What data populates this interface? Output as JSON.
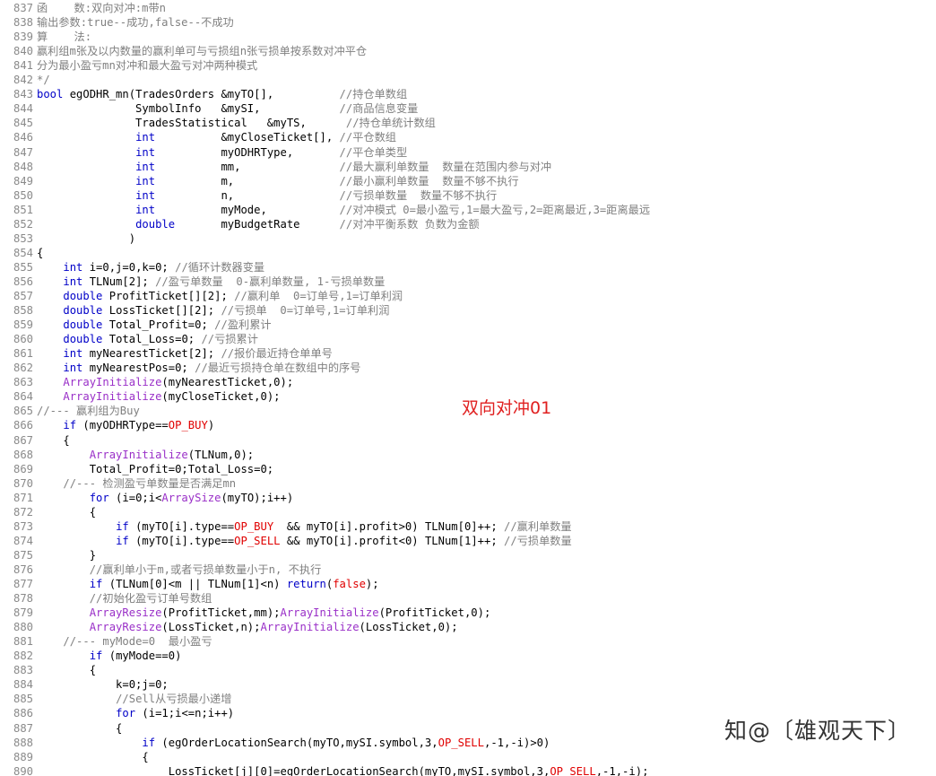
{
  "lines": [
    {
      "n": "837",
      "segs": [
        {
          "t": "函    数:双向对冲:m带n",
          "c": "cm"
        }
      ]
    },
    {
      "n": "838",
      "segs": [
        {
          "t": "输出参数:true--成功,false--不成功",
          "c": "cm"
        }
      ]
    },
    {
      "n": "839",
      "segs": [
        {
          "t": "算    法:",
          "c": "cm"
        }
      ]
    },
    {
      "n": "840",
      "segs": [
        {
          "t": "赢利组m张及以内数量的赢利单可与亏损组n张亏损单按系数对冲平仓",
          "c": "cm"
        }
      ]
    },
    {
      "n": "841",
      "segs": [
        {
          "t": "分为最小盈亏mn对冲和最大盈亏对冲两种模式",
          "c": "cm"
        }
      ]
    },
    {
      "n": "842",
      "segs": [
        {
          "t": "*/",
          "c": "cm"
        }
      ]
    },
    {
      "n": "843",
      "segs": [
        {
          "t": "bool",
          "c": "kw"
        },
        {
          "t": " egODHR_mn(TradesOrders &myTO[],          ",
          "c": ""
        },
        {
          "t": "//持仓单数组",
          "c": "cm"
        }
      ]
    },
    {
      "n": "844",
      "segs": [
        {
          "t": "               SymbolInfo   &mySI,            ",
          "c": ""
        },
        {
          "t": "//商品信息变量",
          "c": "cm"
        }
      ]
    },
    {
      "n": "845",
      "segs": [
        {
          "t": "               TradesStatistical   &myTS,      ",
          "c": ""
        },
        {
          "t": "//持仓单统计数组",
          "c": "cm"
        }
      ]
    },
    {
      "n": "846",
      "segs": [
        {
          "t": "               ",
          "c": ""
        },
        {
          "t": "int",
          "c": "kw"
        },
        {
          "t": "          &myCloseTicket[], ",
          "c": ""
        },
        {
          "t": "//平仓数组",
          "c": "cm"
        }
      ]
    },
    {
      "n": "847",
      "segs": [
        {
          "t": "               ",
          "c": ""
        },
        {
          "t": "int",
          "c": "kw"
        },
        {
          "t": "          myODHRType,       ",
          "c": ""
        },
        {
          "t": "//平仓单类型",
          "c": "cm"
        }
      ]
    },
    {
      "n": "848",
      "segs": [
        {
          "t": "               ",
          "c": ""
        },
        {
          "t": "int",
          "c": "kw"
        },
        {
          "t": "          mm,               ",
          "c": ""
        },
        {
          "t": "//最大赢利单数量  数量在范围内参与对冲",
          "c": "cm"
        }
      ]
    },
    {
      "n": "849",
      "segs": [
        {
          "t": "               ",
          "c": ""
        },
        {
          "t": "int",
          "c": "kw"
        },
        {
          "t": "          m,                ",
          "c": ""
        },
        {
          "t": "//最小赢利单数量  数量不够不执行",
          "c": "cm"
        }
      ]
    },
    {
      "n": "850",
      "segs": [
        {
          "t": "               ",
          "c": ""
        },
        {
          "t": "int",
          "c": "kw"
        },
        {
          "t": "          n,                ",
          "c": ""
        },
        {
          "t": "//亏损单数量  数量不够不执行",
          "c": "cm"
        }
      ]
    },
    {
      "n": "851",
      "segs": [
        {
          "t": "               ",
          "c": ""
        },
        {
          "t": "int",
          "c": "kw"
        },
        {
          "t": "          myMode,           ",
          "c": ""
        },
        {
          "t": "//对冲模式 0=最小盈亏,1=最大盈亏,2=距离最近,3=距离最远",
          "c": "cm"
        }
      ]
    },
    {
      "n": "852",
      "segs": [
        {
          "t": "               ",
          "c": ""
        },
        {
          "t": "double",
          "c": "kw"
        },
        {
          "t": "       myBudgetRate      ",
          "c": ""
        },
        {
          "t": "//对冲平衡系数 负数为金额",
          "c": "cm"
        }
      ]
    },
    {
      "n": "853",
      "segs": [
        {
          "t": "              )",
          "c": ""
        }
      ]
    },
    {
      "n": "854",
      "segs": [
        {
          "t": "{",
          "c": ""
        }
      ]
    },
    {
      "n": "855",
      "segs": [
        {
          "t": "    ",
          "c": ""
        },
        {
          "t": "int",
          "c": "kw"
        },
        {
          "t": " i=0,j=0,k=0; ",
          "c": ""
        },
        {
          "t": "//循环计数器变量",
          "c": "cm"
        }
      ]
    },
    {
      "n": "856",
      "segs": [
        {
          "t": "    ",
          "c": ""
        },
        {
          "t": "int",
          "c": "kw"
        },
        {
          "t": " TLNum[2]; ",
          "c": ""
        },
        {
          "t": "//盈亏单数量  0-赢利单数量, 1-亏损单数量",
          "c": "cm"
        }
      ]
    },
    {
      "n": "857",
      "segs": [
        {
          "t": "    ",
          "c": ""
        },
        {
          "t": "double",
          "c": "kw"
        },
        {
          "t": " ProfitTicket[][2]; ",
          "c": ""
        },
        {
          "t": "//赢利单  0=订单号,1=订单利润",
          "c": "cm"
        }
      ]
    },
    {
      "n": "858",
      "segs": [
        {
          "t": "    ",
          "c": ""
        },
        {
          "t": "double",
          "c": "kw"
        },
        {
          "t": " LossTicket[][2]; ",
          "c": ""
        },
        {
          "t": "//亏损单  0=订单号,1=订单利润",
          "c": "cm"
        }
      ]
    },
    {
      "n": "859",
      "segs": [
        {
          "t": "    ",
          "c": ""
        },
        {
          "t": "double",
          "c": "kw"
        },
        {
          "t": " Total_Profit=0; ",
          "c": ""
        },
        {
          "t": "//盈利累计",
          "c": "cm"
        }
      ]
    },
    {
      "n": "860",
      "segs": [
        {
          "t": "    ",
          "c": ""
        },
        {
          "t": "double",
          "c": "kw"
        },
        {
          "t": " Total_Loss=0; ",
          "c": ""
        },
        {
          "t": "//亏损累计",
          "c": "cm"
        }
      ]
    },
    {
      "n": "861",
      "segs": [
        {
          "t": "    ",
          "c": ""
        },
        {
          "t": "int",
          "c": "kw"
        },
        {
          "t": " myNearestTicket[2]; ",
          "c": ""
        },
        {
          "t": "//报价最近持仓单单号",
          "c": "cm"
        }
      ]
    },
    {
      "n": "862",
      "segs": [
        {
          "t": "    ",
          "c": ""
        },
        {
          "t": "int",
          "c": "kw"
        },
        {
          "t": " myNearestPos=0; ",
          "c": ""
        },
        {
          "t": "//最近亏损持仓单在数组中的序号",
          "c": "cm"
        }
      ]
    },
    {
      "n": "863",
      "segs": [
        {
          "t": "    ",
          "c": ""
        },
        {
          "t": "ArrayInitialize",
          "c": "fn"
        },
        {
          "t": "(myNearestTicket,0);",
          "c": ""
        }
      ]
    },
    {
      "n": "864",
      "segs": [
        {
          "t": "    ",
          "c": ""
        },
        {
          "t": "ArrayInitialize",
          "c": "fn"
        },
        {
          "t": "(myCloseTicket,0);",
          "c": ""
        }
      ]
    },
    {
      "n": "865",
      "segs": [
        {
          "t": "//--- 赢利组为Buy",
          "c": "cm"
        }
      ]
    },
    {
      "n": "866",
      "segs": [
        {
          "t": "    ",
          "c": ""
        },
        {
          "t": "if",
          "c": "kw"
        },
        {
          "t": " (myODHRType==",
          "c": ""
        },
        {
          "t": "OP_BUY",
          "c": "cn"
        },
        {
          "t": ")",
          "c": ""
        }
      ]
    },
    {
      "n": "867",
      "segs": [
        {
          "t": "    {",
          "c": ""
        }
      ]
    },
    {
      "n": "868",
      "segs": [
        {
          "t": "        ",
          "c": ""
        },
        {
          "t": "ArrayInitialize",
          "c": "fn"
        },
        {
          "t": "(TLNum,0);",
          "c": ""
        }
      ]
    },
    {
      "n": "869",
      "segs": [
        {
          "t": "        Total_Profit=0;Total_Loss=0;",
          "c": ""
        }
      ]
    },
    {
      "n": "870",
      "segs": [
        {
          "t": "    ",
          "c": ""
        },
        {
          "t": "//--- 检测盈亏单数量是否满足mn",
          "c": "cm"
        }
      ]
    },
    {
      "n": "871",
      "segs": [
        {
          "t": "        ",
          "c": ""
        },
        {
          "t": "for",
          "c": "kw"
        },
        {
          "t": " (i=0;i<",
          "c": ""
        },
        {
          "t": "ArraySize",
          "c": "fn"
        },
        {
          "t": "(myTO);i++)",
          "c": ""
        }
      ]
    },
    {
      "n": "872",
      "segs": [
        {
          "t": "        {",
          "c": ""
        }
      ]
    },
    {
      "n": "873",
      "segs": [
        {
          "t": "            ",
          "c": ""
        },
        {
          "t": "if",
          "c": "kw"
        },
        {
          "t": " (myTO[i].type==",
          "c": ""
        },
        {
          "t": "OP_BUY",
          "c": "cn"
        },
        {
          "t": "  && myTO[i].profit>0) TLNum[0]++; ",
          "c": ""
        },
        {
          "t": "//赢利单数量",
          "c": "cm"
        }
      ]
    },
    {
      "n": "874",
      "segs": [
        {
          "t": "            ",
          "c": ""
        },
        {
          "t": "if",
          "c": "kw"
        },
        {
          "t": " (myTO[i].type==",
          "c": ""
        },
        {
          "t": "OP_SELL",
          "c": "cn"
        },
        {
          "t": " && myTO[i].profit<0) TLNum[1]++; ",
          "c": ""
        },
        {
          "t": "//亏损单数量",
          "c": "cm"
        }
      ]
    },
    {
      "n": "875",
      "segs": [
        {
          "t": "        }",
          "c": ""
        }
      ]
    },
    {
      "n": "876",
      "segs": [
        {
          "t": "        ",
          "c": ""
        },
        {
          "t": "//赢利单小于m,或者亏损单数量小于n, 不执行",
          "c": "cm"
        }
      ]
    },
    {
      "n": "877",
      "segs": [
        {
          "t": "        ",
          "c": ""
        },
        {
          "t": "if",
          "c": "kw"
        },
        {
          "t": " (TLNum[0]<m || TLNum[1]<n) ",
          "c": ""
        },
        {
          "t": "return",
          "c": "kw"
        },
        {
          "t": "(",
          "c": ""
        },
        {
          "t": "false",
          "c": "cn"
        },
        {
          "t": ");",
          "c": ""
        }
      ]
    },
    {
      "n": "878",
      "segs": [
        {
          "t": "        ",
          "c": ""
        },
        {
          "t": "//初始化盈亏订单号数组",
          "c": "cm"
        }
      ]
    },
    {
      "n": "879",
      "segs": [
        {
          "t": "        ",
          "c": ""
        },
        {
          "t": "ArrayResize",
          "c": "fn"
        },
        {
          "t": "(ProfitTicket,mm);",
          "c": ""
        },
        {
          "t": "ArrayInitialize",
          "c": "fn"
        },
        {
          "t": "(ProfitTicket,0);",
          "c": ""
        }
      ]
    },
    {
      "n": "880",
      "segs": [
        {
          "t": "        ",
          "c": ""
        },
        {
          "t": "ArrayResize",
          "c": "fn"
        },
        {
          "t": "(LossTicket,n);",
          "c": ""
        },
        {
          "t": "ArrayInitialize",
          "c": "fn"
        },
        {
          "t": "(LossTicket,0);",
          "c": ""
        }
      ]
    },
    {
      "n": "881",
      "segs": [
        {
          "t": "    ",
          "c": ""
        },
        {
          "t": "//--- myMode=0  最小盈亏",
          "c": "cm"
        }
      ]
    },
    {
      "n": "882",
      "segs": [
        {
          "t": "        ",
          "c": ""
        },
        {
          "t": "if",
          "c": "kw"
        },
        {
          "t": " (myMode==0)",
          "c": ""
        }
      ]
    },
    {
      "n": "883",
      "segs": [
        {
          "t": "        {",
          "c": ""
        }
      ]
    },
    {
      "n": "884",
      "segs": [
        {
          "t": "            k=0;j=0;",
          "c": ""
        }
      ]
    },
    {
      "n": "885",
      "segs": [
        {
          "t": "            ",
          "c": ""
        },
        {
          "t": "//Sell从亏损最小递增",
          "c": "cm"
        }
      ]
    },
    {
      "n": "886",
      "segs": [
        {
          "t": "            ",
          "c": ""
        },
        {
          "t": "for",
          "c": "kw"
        },
        {
          "t": " (i=1;i<=n;i++)",
          "c": ""
        }
      ]
    },
    {
      "n": "887",
      "segs": [
        {
          "t": "            {",
          "c": ""
        }
      ]
    },
    {
      "n": "888",
      "segs": [
        {
          "t": "                ",
          "c": ""
        },
        {
          "t": "if",
          "c": "kw"
        },
        {
          "t": " (egOrderLocationSearch(myTO,mySI.symbol,3,",
          "c": ""
        },
        {
          "t": "OP_SELL",
          "c": "cn"
        },
        {
          "t": ",-1,-i)>0)",
          "c": ""
        }
      ]
    },
    {
      "n": "889",
      "segs": [
        {
          "t": "                {",
          "c": ""
        }
      ]
    },
    {
      "n": "890",
      "segs": [
        {
          "t": "                    LossTicket[j][0]=egOrderLocationSearch(myTO,mySI.symbol,3,",
          "c": ""
        },
        {
          "t": "OP_SELL",
          "c": "cn"
        },
        {
          "t": ",-1,-i);",
          "c": ""
        }
      ]
    }
  ],
  "overlay_text": "双向对冲01",
  "watermark": "知@〔雄观天下〕",
  "colors": {
    "comment": "#808080",
    "keyword": "#0000c8",
    "function": "#9a30c8",
    "constant": "#e00000",
    "line_number": "#8a8a8a",
    "overlay": "#e02020"
  }
}
